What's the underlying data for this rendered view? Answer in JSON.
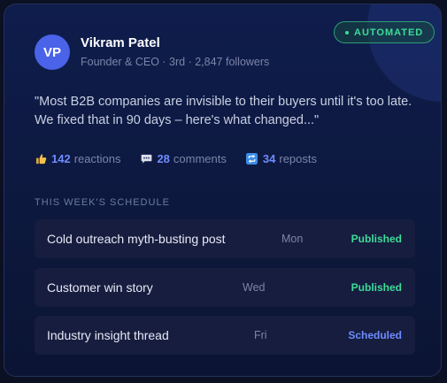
{
  "badge": {
    "label": "AUTOMATED",
    "color": "#3ddc97"
  },
  "author": {
    "initials": "VP",
    "name": "Vikram Patel",
    "meta": "Founder & CEO · 3rd · 2,847 followers",
    "avatar_color": "#4a63e8"
  },
  "post": {
    "text": "\"Most B2B companies are invisible to their buyers until it's too late. We fixed that in 90 days – here's what changed...\""
  },
  "stats": {
    "reactions": {
      "count": "142",
      "label": "reactions",
      "icon": "thumbs-up-icon"
    },
    "comments": {
      "count": "28",
      "label": "comments",
      "icon": "comment-bubble-icon"
    },
    "reposts": {
      "count": "34",
      "label": "reposts",
      "icon": "repost-icon"
    }
  },
  "schedule": {
    "label": "THIS WEEK'S SCHEDULE",
    "items": [
      {
        "title": "Cold outreach myth-busting post",
        "day": "Mon",
        "status": "Published",
        "status_color": "#3ddc97"
      },
      {
        "title": "Customer win story",
        "day": "Wed",
        "status": "Published",
        "status_color": "#3ddc97"
      },
      {
        "title": "Industry insight thread",
        "day": "Fri",
        "status": "Scheduled",
        "status_color": "#6f8cff"
      }
    ]
  }
}
